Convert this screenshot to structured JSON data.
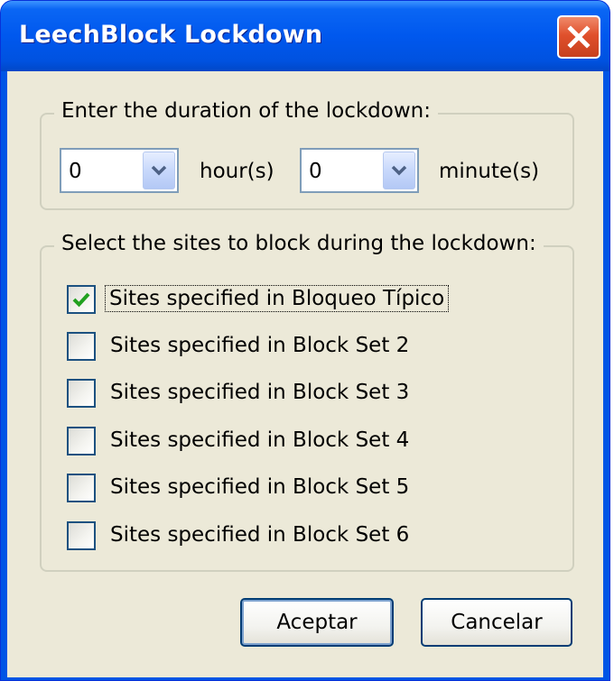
{
  "window": {
    "title": "LeechBlock Lockdown"
  },
  "duration": {
    "legend": "Enter the duration of the lockdown:",
    "hours_value": "0",
    "hours_unit": "hour(s)",
    "minutes_value": "0",
    "minutes_unit": "minute(s)"
  },
  "sites": {
    "legend": "Select the sites to block during the lockdown:",
    "items": [
      {
        "label": "Sites specified in Bloqueo Típico",
        "checked": true
      },
      {
        "label": "Sites specified in Block Set 2",
        "checked": false
      },
      {
        "label": "Sites specified in Block Set 3",
        "checked": false
      },
      {
        "label": "Sites specified in Block Set 4",
        "checked": false
      },
      {
        "label": "Sites specified in Block Set 5",
        "checked": false
      },
      {
        "label": "Sites specified in Block Set 6",
        "checked": false
      }
    ]
  },
  "buttons": {
    "ok_label": "Aceptar",
    "cancel_label": "Cancelar"
  },
  "icons": {
    "close": "close-icon",
    "dropdown": "chevron-down-icon",
    "check": "checkmark-icon"
  },
  "colors": {
    "titlebar": "#0058ee",
    "client": "#ece9d8",
    "close": "#e0502c",
    "check": "#21a121"
  }
}
